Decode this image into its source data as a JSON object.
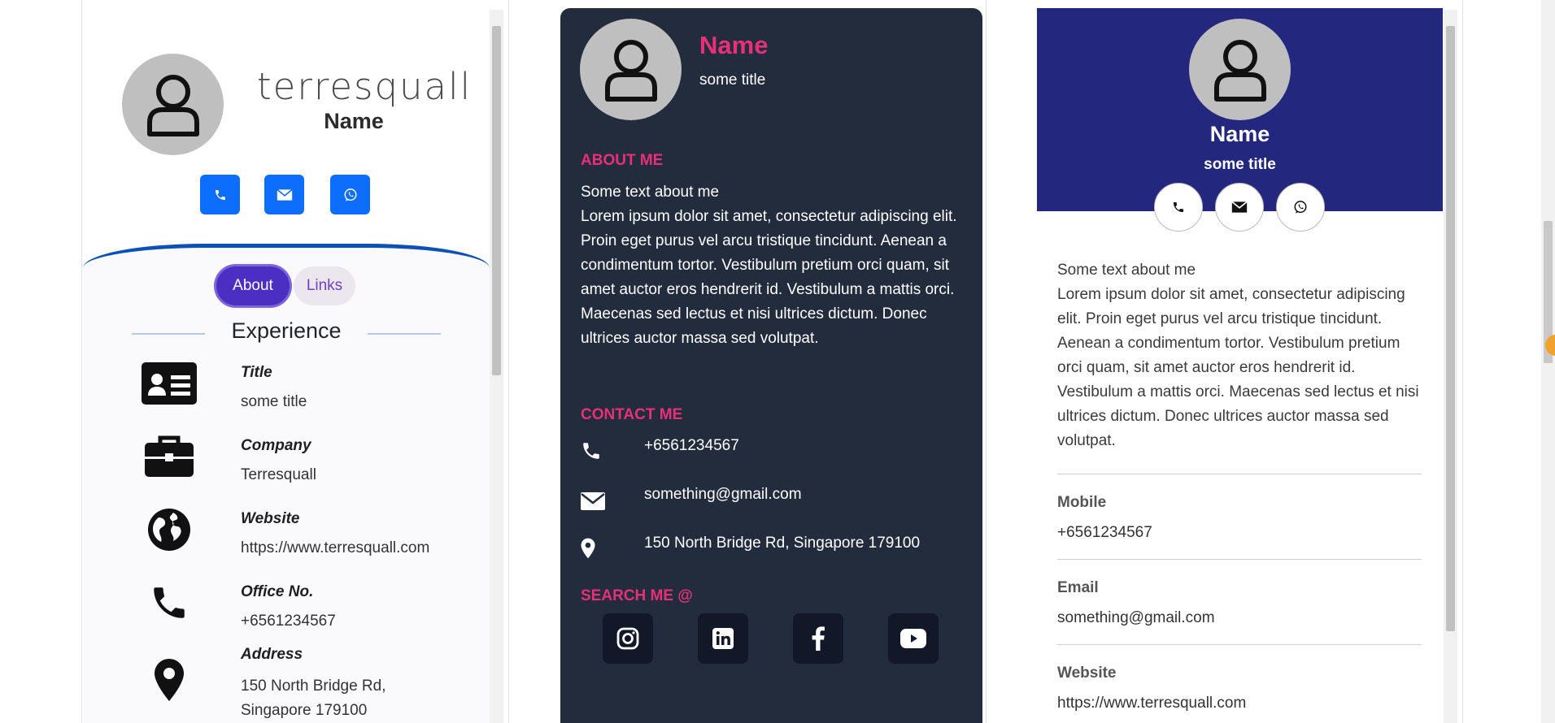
{
  "card_classic": {
    "brand": "terresquall",
    "name": "Name",
    "actions": [
      "phone-button",
      "email-button",
      "whatsapp-button"
    ],
    "tabs": [
      {
        "label": "About",
        "active": true
      },
      {
        "label": "Links",
        "active": false
      }
    ],
    "section_title": "Experience",
    "rows": [
      {
        "icon": "id-card-icon",
        "label": "Title",
        "value": "some title"
      },
      {
        "icon": "briefcase-icon",
        "label": "Company",
        "value": "Terresquall"
      },
      {
        "icon": "globe-icon",
        "label": "Website",
        "value": "https://www.terresquall.com"
      },
      {
        "icon": "phone-icon",
        "label": "Office No.",
        "value": "+6561234567"
      },
      {
        "icon": "map-pin-icon",
        "label": "Address",
        "value": "150 North Bridge Rd, Singapore 179100"
      }
    ]
  },
  "card_dark": {
    "name": "Name",
    "title": "some title",
    "about_heading": "ABOUT ME",
    "about_text_1": "Some text about me",
    "about_text_2": "Lorem ipsum dolor sit amet, consectetur adipiscing elit. Proin eget purus vel arcu tristique tincidunt. Aenean a condimentum tortor. Vestibulum pretium orci quam, sit amet auctor eros hendrerit id. Vestibulum a mattis orci. Maecenas sed lectus et nisi ultrices dictum. Donec ultrices auctor massa sed volutpat.",
    "contact_heading": "CONTACT ME",
    "contacts": [
      {
        "icon": "phone-icon",
        "value": "+6561234567"
      },
      {
        "icon": "envelope-icon",
        "value": "something@gmail.com"
      },
      {
        "icon": "map-pin-icon",
        "value": "150 North Bridge Rd, Singapore 179100"
      }
    ],
    "search_heading": "SEARCH ME @",
    "socials": [
      "instagram-icon",
      "linkedin-icon",
      "facebook-icon",
      "youtube-icon"
    ]
  },
  "card_banner": {
    "name": "Name",
    "title": "some title",
    "actions": [
      "phone-button",
      "email-button",
      "whatsapp-button"
    ],
    "about_text_1": "Some text about me",
    "about_text_2": "Lorem ipsum dolor sit amet, consectetur adipiscing elit. Proin eget purus vel arcu tristique tincidunt. Aenean a condimentum tortor. Vestibulum pretium orci quam, sit amet auctor eros hendrerit id. Vestibulum a mattis orci. Maecenas sed lectus et nisi ultrices dictum. Donec ultrices auctor massa sed volutpat.",
    "fields": [
      {
        "label": "Mobile",
        "value": "+6561234567"
      },
      {
        "label": "Email",
        "value": "something@gmail.com"
      },
      {
        "label": "Website",
        "value": "https://www.terresquall.com"
      }
    ]
  },
  "colors": {
    "accent_blue": "#0d6efd",
    "dark_bg": "#222c3c",
    "pink": "#e8307a",
    "banner_navy": "#23277e",
    "tab_purple": "#4b2ec2"
  }
}
